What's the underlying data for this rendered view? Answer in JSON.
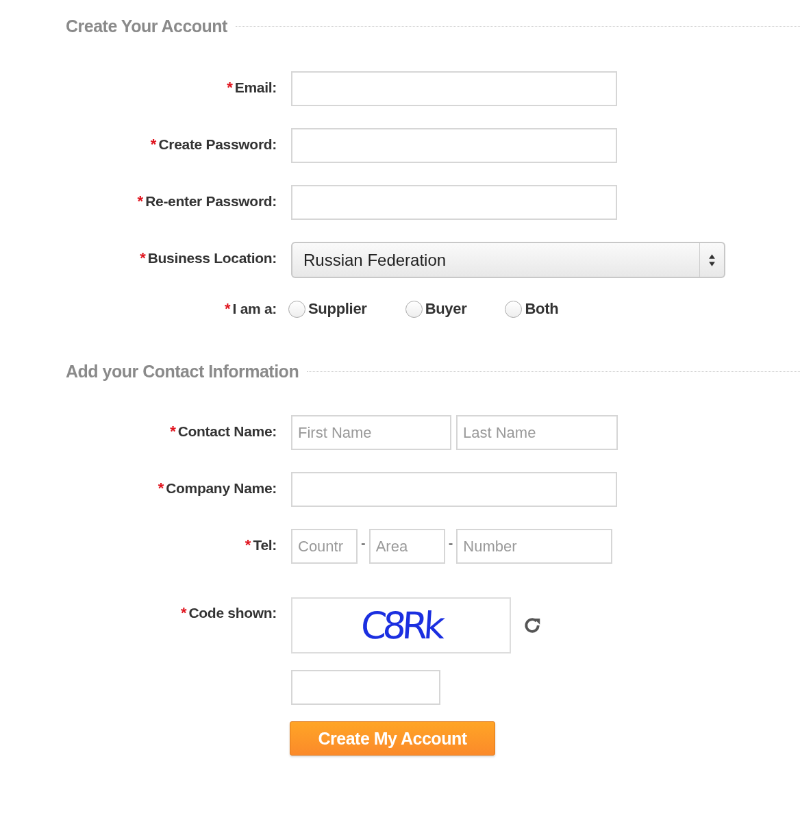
{
  "sections": [
    {
      "title": "Create Your Account",
      "rows": [
        {
          "kind": "text",
          "marker": "*",
          "label": "Email:"
        },
        {
          "kind": "text",
          "marker": "*",
          "label": "Create Password:"
        },
        {
          "kind": "text",
          "marker": "*",
          "label": "Re-enter Password:"
        },
        {
          "kind": "select",
          "marker": "*",
          "label": "Business Location:",
          "value": "Russian Federation"
        },
        {
          "kind": "radio",
          "marker": "*",
          "label": "I am a:",
          "options": [
            {
              "label": "Supplier",
              "selected": false
            },
            {
              "label": "Buyer",
              "selected": false
            },
            {
              "label": "Both",
              "selected": false
            }
          ]
        }
      ]
    },
    {
      "title": "Add your Contact Information",
      "rows": [
        {
          "kind": "parts",
          "marker": "*",
          "label": "Contact Name:",
          "parts": [
            {
              "kind": "field",
              "placeholder": "First Name"
            },
            {
              "kind": "field",
              "placeholder": "Last Name"
            }
          ]
        },
        {
          "kind": "text",
          "marker": "*",
          "label": "Company Name:"
        },
        {
          "kind": "parts",
          "marker": "*",
          "label": "Tel:",
          "parts": [
            {
              "kind": "field",
              "placeholder": "Countr"
            },
            {
              "kind": "separator",
              "text": "-"
            },
            {
              "kind": "field",
              "placeholder": "Area"
            },
            {
              "kind": "separator",
              "text": "-"
            },
            {
              "kind": "field",
              "placeholder": "Number"
            }
          ]
        },
        {
          "kind": "captcha",
          "marker": "*",
          "label": "Code shown:",
          "code": "C8Rk"
        }
      ]
    }
  ],
  "submit": "Create My Account"
}
